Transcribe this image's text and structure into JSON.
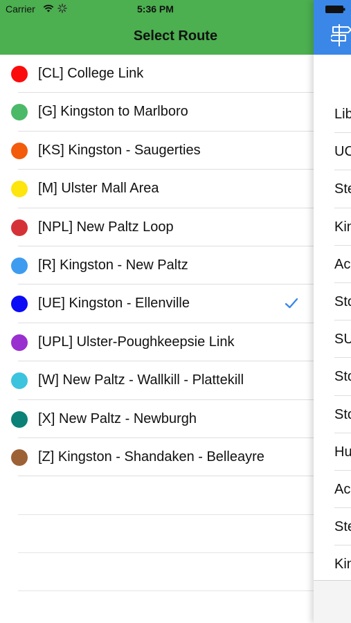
{
  "status_bar": {
    "carrier": "Carrier",
    "time": "5:36 PM"
  },
  "nav": {
    "title": "Select Route"
  },
  "routes": [
    {
      "label": "[CL] College Link",
      "color": "#fb0c0c",
      "selected": false
    },
    {
      "label": "[G] Kingston to Marlboro",
      "color": "#4cb968",
      "selected": false
    },
    {
      "label": "[KS] Kingston - Saugerties",
      "color": "#f25c0a",
      "selected": false
    },
    {
      "label": "[M] Ulster Mall Area",
      "color": "#fde50d",
      "selected": false
    },
    {
      "label": "[NPL] New Paltz Loop",
      "color": "#d53237",
      "selected": false
    },
    {
      "label": "[R] Kingston - New Paltz",
      "color": "#3e9cf0",
      "selected": false
    },
    {
      "label": "[UE] Kingston - Ellenville",
      "color": "#0b0bf5",
      "selected": true
    },
    {
      "label": "[UPL] Ulster-Poughkeepsie Link",
      "color": "#9a2fcf",
      "selected": false
    },
    {
      "label": "[W] New Paltz - Wallkill - Plattekill",
      "color": "#3cc3de",
      "selected": false
    },
    {
      "label": "[X] New Paltz - Newburgh",
      "color": "#0c8178",
      "selected": false
    },
    {
      "label": "[Z] Kingston - Shandaken - Belleayre",
      "color": "#9c6236",
      "selected": false
    }
  ],
  "accent": {
    "nav_green": "#4caf50",
    "check_blue": "#3b87e8",
    "right_header_blue": "#3b87e8"
  },
  "stops_panel": {
    "stops": [
      "Lib",
      "UC",
      "Ste",
      "Kin",
      "Ac",
      "Sto",
      "SU",
      "Sto",
      "Sto",
      "Hu",
      "Ac",
      "Ste",
      "Kin"
    ]
  }
}
